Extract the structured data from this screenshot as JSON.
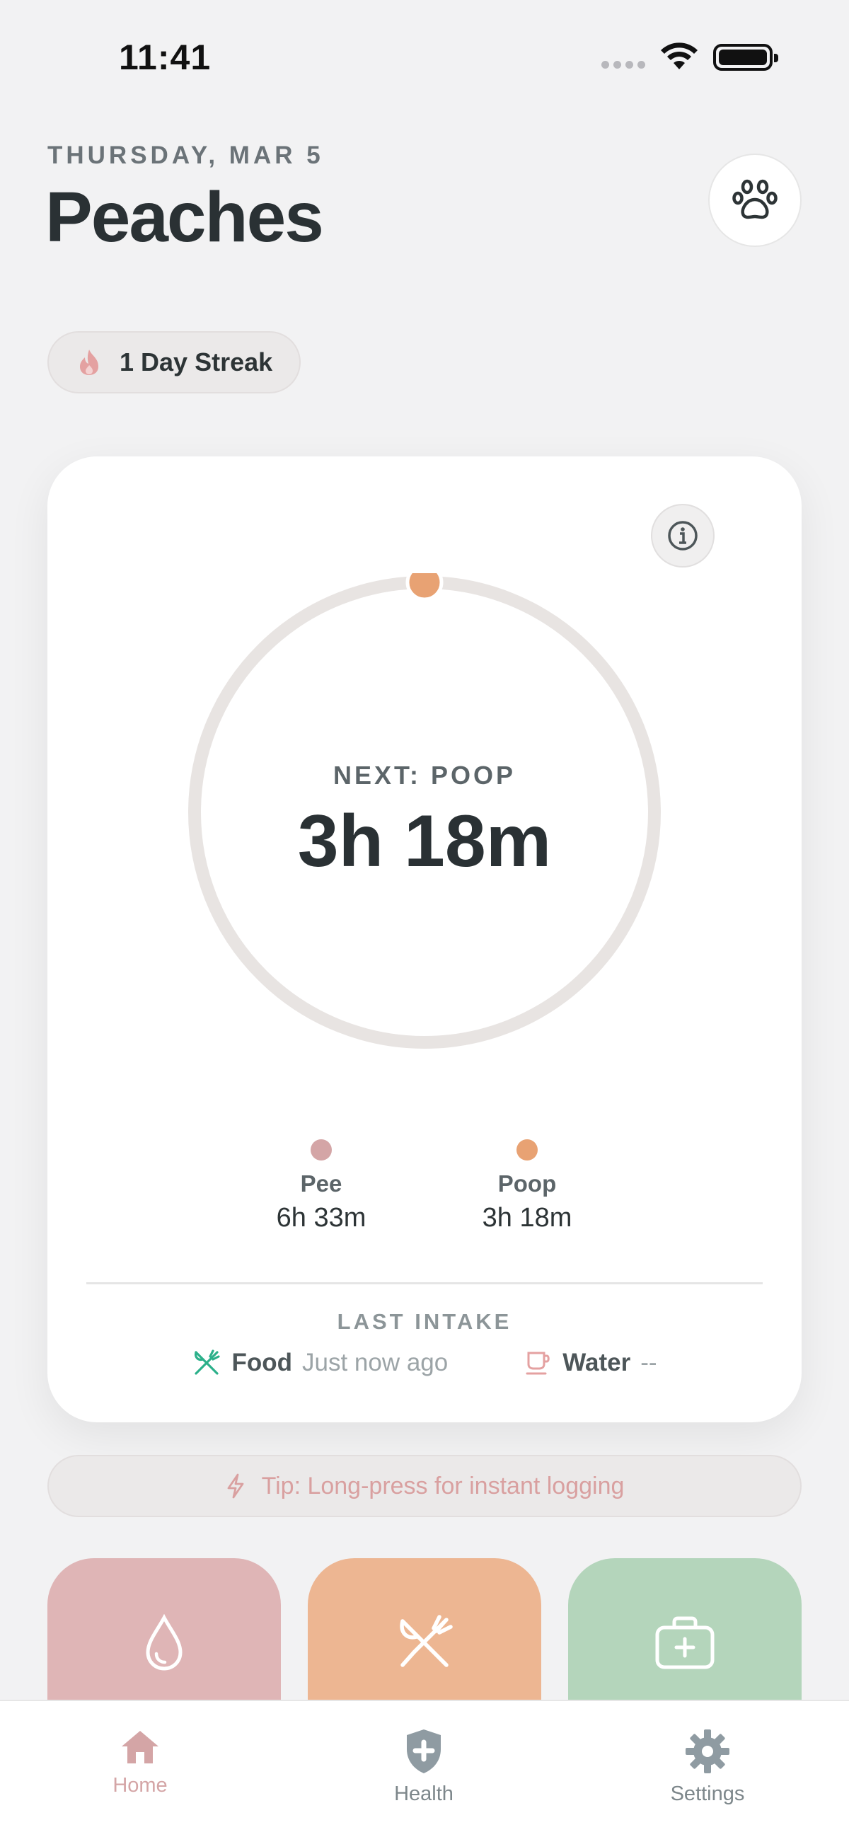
{
  "status_bar": {
    "time": "11:41"
  },
  "header": {
    "date": "THURSDAY, MAR 5",
    "pet_name": "Peaches"
  },
  "streak": {
    "label": "1 Day Streak"
  },
  "timer": {
    "next_label": "NEXT: POOP",
    "next_time": "3h 18m",
    "legend": [
      {
        "name": "Pee",
        "value": "6h 33m",
        "color": "#d4a5a6"
      },
      {
        "name": "Poop",
        "value": "3h 18m",
        "color": "#e8a273"
      }
    ]
  },
  "last_intake": {
    "label": "LAST INTAKE",
    "food": {
      "name": "Food",
      "time": "Just now ago"
    },
    "water": {
      "name": "Water",
      "time": "--"
    }
  },
  "tip": {
    "text": "Tip: Long-press for instant logging"
  },
  "actions": [
    {
      "icon": "droplet-icon",
      "color": "#dfb5b6"
    },
    {
      "icon": "fork-knife-icon",
      "color": "#edb692"
    },
    {
      "icon": "first-aid-kit-icon",
      "color": "#b4d5bb"
    }
  ],
  "tabs": [
    {
      "label": "Home",
      "active": true
    },
    {
      "label": "Health",
      "active": false
    },
    {
      "label": "Settings",
      "active": false
    }
  ],
  "colors": {
    "accent_pink": "#d4a5a6",
    "accent_orange": "#e8a273",
    "accent_green": "#2bb08a",
    "text_dark": "#2a3134"
  }
}
